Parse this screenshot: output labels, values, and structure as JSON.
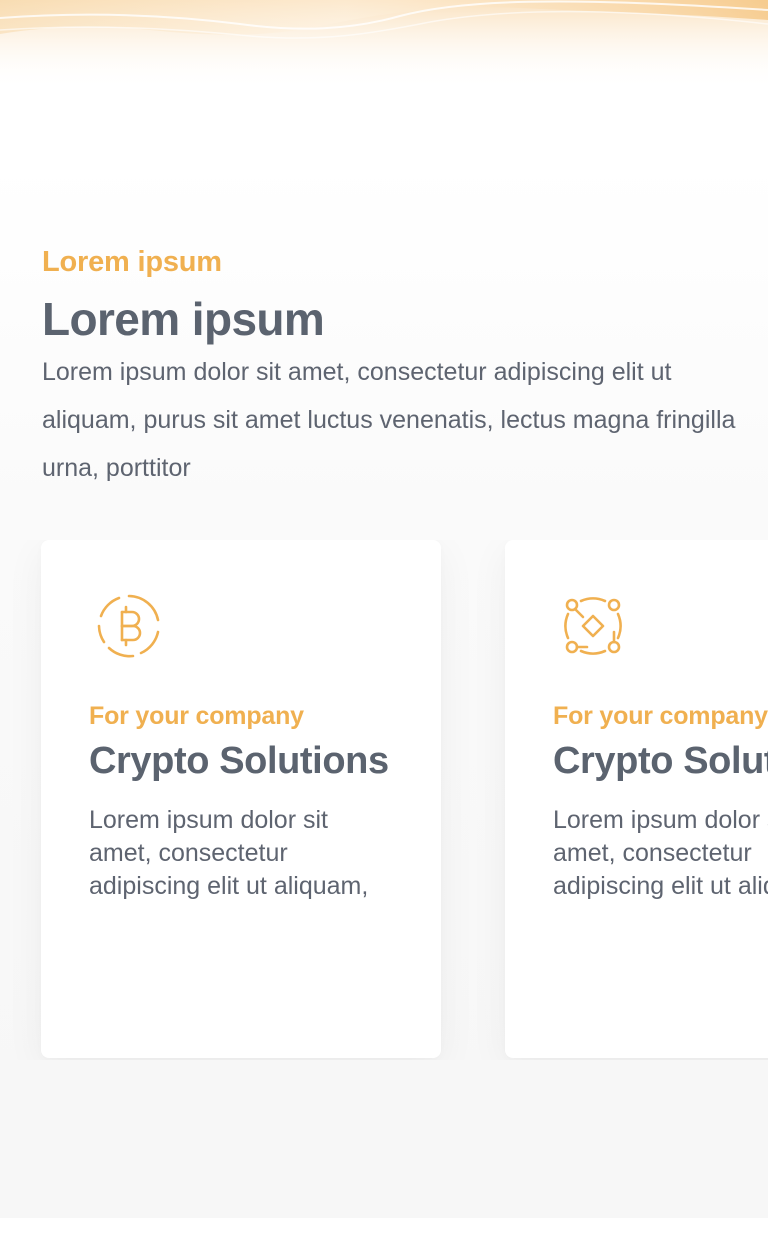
{
  "colors": {
    "accent": "#f0b050",
    "heading": "#5b636f",
    "body_text": "#5e6470",
    "background": "#f7f7f7",
    "card": "#ffffff"
  },
  "section": {
    "eyebrow": "Lorem ipsum",
    "title": "Lorem ipsum",
    "description": "Lorem ipsum dolor sit amet, consectetur adipiscing elit ut aliquam, purus sit amet luctus venenatis, lectus magna fringilla urna, porttitor"
  },
  "cards": [
    {
      "icon": "bitcoin-icon",
      "eyebrow": "For your company",
      "title": "Crypto Solutions",
      "text": "Lorem ipsum dolor sit amet, consectetur adipiscing elit ut aliquam,"
    },
    {
      "icon": "blockchain-network-icon",
      "eyebrow": "For your company",
      "title": "Crypto Solutions",
      "text": "Lorem ipsum dolor sit amet, consectetur adipiscing elit ut aliquam,"
    }
  ]
}
